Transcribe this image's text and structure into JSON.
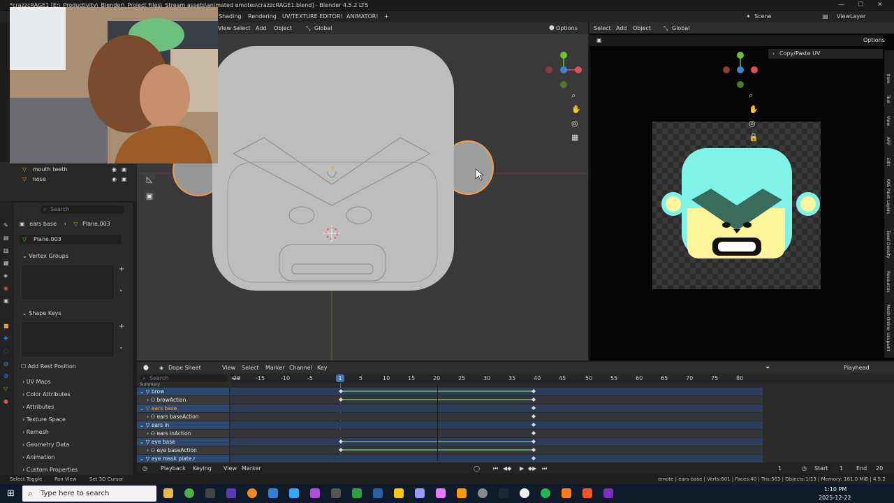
{
  "window": {
    "title": "*crazzcRAGE1 [E:\\_Productivity\\_Blender\\_Project Files\\_Stream assets\\animated emotes\\crazzcRAGE1.blend] - Blender 4.5.2 LTS",
    "min": "—",
    "max": "☐",
    "close": "✕"
  },
  "workspace_tabs": [
    "Shading",
    "Rendering",
    "UV/TEXTURE EDITOR!",
    "ANIMATOR!",
    "+"
  ],
  "scene": {
    "scene_label": "Scene",
    "viewlayer_label": "ViewLayer"
  },
  "viewport": {
    "menu": [
      "View",
      "Select",
      "Add",
      "Object"
    ],
    "transform": "Global",
    "options": "Options"
  },
  "uv_editor": {
    "menu": [
      "Select",
      "Add",
      "Object"
    ],
    "transform": "Global",
    "options": "Options",
    "panel": "Copy/Paste UV",
    "side_tabs": [
      "Item",
      "Tool",
      "View",
      "ARP",
      "Edit",
      "KAS Paint Layers",
      "Texel Density",
      "Resources",
      "Mesh Online",
      "Ucupaint"
    ]
  },
  "outliner": {
    "items": [
      {
        "label": "mouth teeth"
      },
      {
        "label": "nose"
      }
    ]
  },
  "properties": {
    "search_placeholder": "Search",
    "breadcrumb_object": "ears base",
    "breadcrumb_mesh": "Plane.003",
    "mesh_name": "Plane.003",
    "vertex_groups": "Vertex Groups",
    "shape_keys": "Shape Keys",
    "add_rest_position": "Add Rest Position",
    "sections": [
      "UV Maps",
      "Color Attributes",
      "Attributes",
      "Texture Space",
      "Remesh",
      "Geometry Data",
      "Animation",
      "Custom Properties"
    ]
  },
  "dope_sheet": {
    "editor": "Dope Sheet",
    "menu": [
      "View",
      "Select",
      "Marker",
      "Channel",
      "Key"
    ],
    "playhead": "Playhead",
    "search_placeholder": "Search",
    "current_frame": "1",
    "ticks": [
      "-20",
      "-15",
      "-10",
      "-5",
      "5",
      "10",
      "15",
      "20",
      "25",
      "30",
      "35",
      "40",
      "45",
      "50",
      "55",
      "60",
      "65",
      "70",
      "75",
      "80"
    ],
    "summary_label": "Summary",
    "channels": [
      {
        "label": "brow",
        "type": "object"
      },
      {
        "label": "browAction",
        "type": "action"
      },
      {
        "label": "ears base",
        "type": "object-active"
      },
      {
        "label": "ears baseAction",
        "type": "action"
      },
      {
        "label": "ears in",
        "type": "object"
      },
      {
        "label": "ears inAction",
        "type": "action"
      },
      {
        "label": "eye base",
        "type": "object"
      },
      {
        "label": "eye baseAction",
        "type": "action"
      },
      {
        "label": "eye mask plate.r",
        "type": "object"
      }
    ]
  },
  "playback": {
    "menu": [
      "Playback",
      "Keying",
      "View",
      "Marker"
    ],
    "frame": "1",
    "start_label": "Start",
    "start": "1",
    "end_label": "End",
    "end": "20"
  },
  "status": {
    "left": [
      "Select Toggle",
      "Pan View",
      "Set 3D Cursor"
    ],
    "right": "emote | ears base | Verts:601 | Faces:40 | Tris:563 | Objects:1/13 | Memory: 161.0 MiB | 4.5.2"
  },
  "taskbar": {
    "search_placeholder": "Type here to search",
    "time": "1:10 PM",
    "date": "2025-12-22"
  },
  "colors": {
    "accent": "#4772b3",
    "select_orange": "#f5a14a",
    "channel_blue": "#2b4a73",
    "uv_teal": "#7ff3e8",
    "uv_yellow": "#fff59a"
  }
}
